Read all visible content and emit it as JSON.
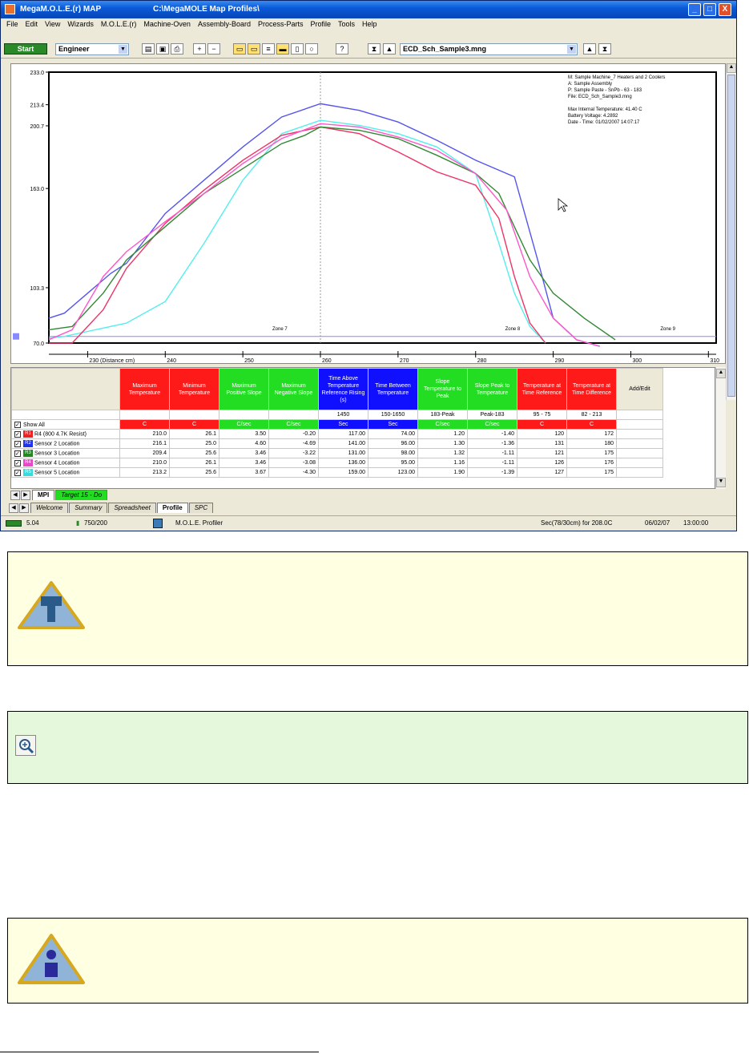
{
  "window": {
    "app_title": "MegaM.O.L.E.(r) MAP",
    "doc_title": "C:\\MegaMOLE Map Profiles\\",
    "minimize": "_",
    "maximize": "□",
    "close": "X"
  },
  "menu": [
    "File",
    "Edit",
    "View",
    "Wizards",
    "M.O.L.E.(r)",
    "Machine-Oven",
    "Assembly-Board",
    "Process-Parts",
    "Profile",
    "Tools",
    "Help"
  ],
  "toolbar": {
    "start_label": "Start",
    "user_level": "Engineer",
    "file_name": "ECD_Sch_Sample3.mng"
  },
  "chart_data": {
    "type": "line",
    "ylim": [
      70.0,
      233.0
    ],
    "xlim": [
      225,
      311
    ],
    "y_ticks": [
      {
        "label": "233.0",
        "v": 233.0
      },
      {
        "label": "213.4",
        "v": 213.4
      },
      {
        "label": "200.7",
        "v": 200.7
      },
      {
        "label": "163.0",
        "v": 163.0
      },
      {
        "label": "103.3",
        "v": 103.3
      },
      {
        "label": "70.0",
        "v": 70.0
      }
    ],
    "x_ticks": [
      {
        "label": "230 (Distance cm)",
        "v": 230
      },
      {
        "label": "240",
        "v": 240
      },
      {
        "label": "250",
        "v": 250
      },
      {
        "label": "260",
        "v": 260
      },
      {
        "label": "270",
        "v": 270
      },
      {
        "label": "280",
        "v": 280
      },
      {
        "label": "290",
        "v": 290
      },
      {
        "label": "300",
        "v": 300
      },
      {
        "label": "310",
        "v": 310
      }
    ],
    "zones": [
      {
        "label": "Zone 7",
        "x": 260
      },
      {
        "label": "Zone 8",
        "x": 290
      },
      {
        "label": "Zone 9",
        "x": 310
      }
    ],
    "series": [
      {
        "color": "#5555ee",
        "x": [
          225,
          227,
          230,
          233,
          235,
          240,
          245,
          250,
          255,
          260,
          265,
          270,
          275,
          280,
          285,
          288,
          290,
          293,
          296
        ],
        "y": [
          85,
          88,
          100,
          112,
          118,
          148,
          168,
          188,
          206,
          214,
          210,
          203,
          192,
          180,
          170,
          120,
          85,
          72,
          68
        ]
      },
      {
        "color": "#55eeee",
        "x": [
          225,
          227,
          230,
          235,
          240,
          245,
          250,
          255,
          260,
          265,
          270,
          275,
          280,
          283,
          285,
          287,
          289
        ],
        "y": [
          73,
          74,
          77,
          82,
          95,
          130,
          168,
          196,
          204,
          201,
          196,
          188,
          172,
          130,
          100,
          80,
          70
        ]
      },
      {
        "color": "#ee3366",
        "x": [
          225,
          228,
          232,
          235,
          240,
          245,
          250,
          255,
          260,
          265,
          270,
          275,
          280,
          283,
          285,
          287,
          289
        ],
        "y": [
          70,
          70,
          90,
          115,
          142,
          162,
          180,
          195,
          200,
          196,
          185,
          173,
          165,
          145,
          110,
          82,
          70
        ]
      },
      {
        "color": "#338833",
        "x": [
          225,
          228,
          232,
          235,
          240,
          245,
          250,
          255,
          258,
          260,
          265,
          270,
          275,
          280,
          283,
          287,
          290,
          294,
          298
        ],
        "y": [
          78,
          80,
          100,
          120,
          140,
          160,
          175,
          190,
          195,
          200,
          198,
          193,
          183,
          172,
          160,
          120,
          100,
          85,
          72
        ]
      },
      {
        "color": "#ff55cc",
        "x": [
          225,
          228,
          232,
          235,
          240,
          245,
          250,
          255,
          260,
          265,
          270,
          275,
          280,
          284,
          287,
          290,
          293,
          296
        ],
        "y": [
          72,
          78,
          110,
          125,
          143,
          160,
          178,
          193,
          202,
          200,
          194,
          186,
          172,
          150,
          110,
          85,
          72,
          68
        ]
      }
    ]
  },
  "chart_info": [
    "M: Sample Machine_7 Heaters and 2 Coolers",
    "A: Sample Assembly",
    "P: Sample Paste - SnPb - 63 - 183",
    "File: ECD_Sch_Sample3.mng",
    "",
    "Max Internal Temperature: 41.40 C",
    "Battery Voltage: 4.2892",
    "Date - Time: 01/02/2007 14:07:17"
  ],
  "grid": {
    "headers": [
      {
        "label": "",
        "color": "gray"
      },
      {
        "label": "Maximum Temperature",
        "color": "red"
      },
      {
        "label": "Minimum Temperature",
        "color": "red"
      },
      {
        "label": "Maximum Positive Slope",
        "color": "green"
      },
      {
        "label": "Maximum Negative Slope",
        "color": "green"
      },
      {
        "label": "Time Above Temperature Reference Rising (s)",
        "color": "blue"
      },
      {
        "label": "Time Between Temperature",
        "color": "blue"
      },
      {
        "label": "Slope Temperature to Peak",
        "color": "green"
      },
      {
        "label": "Slope Peak to Temperature",
        "color": "green"
      },
      {
        "label": "Temperature at Time Reference",
        "color": "red"
      },
      {
        "label": "Temperature at Time Difference",
        "color": "red"
      },
      {
        "label": "Add/Edit",
        "color": "gray"
      }
    ],
    "ref_row": [
      "",
      "",
      "",
      "",
      "",
      "1450",
      "150-1650",
      "183-Peak",
      "Peak-183",
      "95 - 75",
      "82 - 213",
      ""
    ],
    "show_all": "Show All",
    "unit_row": [
      "C",
      "C",
      "C/sec",
      "C/sec",
      "Sec",
      "Sec",
      "C/sec",
      "C/sec",
      "C",
      "C"
    ],
    "rows": [
      {
        "tag": "R1",
        "color": "#ee2222",
        "name": "R4 (800 4.7K Resist)",
        "values": [
          "210.0",
          "26.1",
          "3.50",
          "-0.20",
          "117.00",
          "74.00",
          "1.20",
          "-1.40",
          "120",
          "172"
        ]
      },
      {
        "tag": "R2",
        "color": "#2233ee",
        "name": "Sensor 2 Location",
        "values": [
          "216.1",
          "25.0",
          "4.60",
          "-4.69",
          "141.00",
          "96.00",
          "1.30",
          "-1.36",
          "131",
          "180"
        ]
      },
      {
        "tag": "R3",
        "color": "#228822",
        "name": "Sensor 3 Location",
        "values": [
          "209.4",
          "25.6",
          "3.46",
          "-3.22",
          "131.00",
          "98.00",
          "1.32",
          "-1.11",
          "121",
          "175"
        ]
      },
      {
        "tag": "R4",
        "color": "#ee44cc",
        "name": "Sensor 4 Location",
        "values": [
          "210.0",
          "26.1",
          "3.46",
          "-3.08",
          "136.00",
          "95.00",
          "1.16",
          "-1.11",
          "126",
          "176"
        ]
      },
      {
        "tag": "R5",
        "color": "#33dddd",
        "name": "Sensor 5 Location",
        "values": [
          "213.2",
          "25.6",
          "3.67",
          "-4.30",
          "159.00",
          "123.00",
          "1.90",
          "-1.39",
          "127",
          "175"
        ]
      }
    ]
  },
  "sheet_tabs": [
    "MPI",
    "Target 15 - Do"
  ],
  "view_tabs": [
    "Welcome",
    "Summary",
    "Spreadsheet",
    "Profile",
    "SPC"
  ],
  "status": {
    "battery": "5.04",
    "slots": "750/200",
    "device": "M.O.L.E. Profiler",
    "cursor": "Sec(78/30cm) for 208.0C",
    "date": "06/02/07",
    "time": "13:00:00"
  }
}
